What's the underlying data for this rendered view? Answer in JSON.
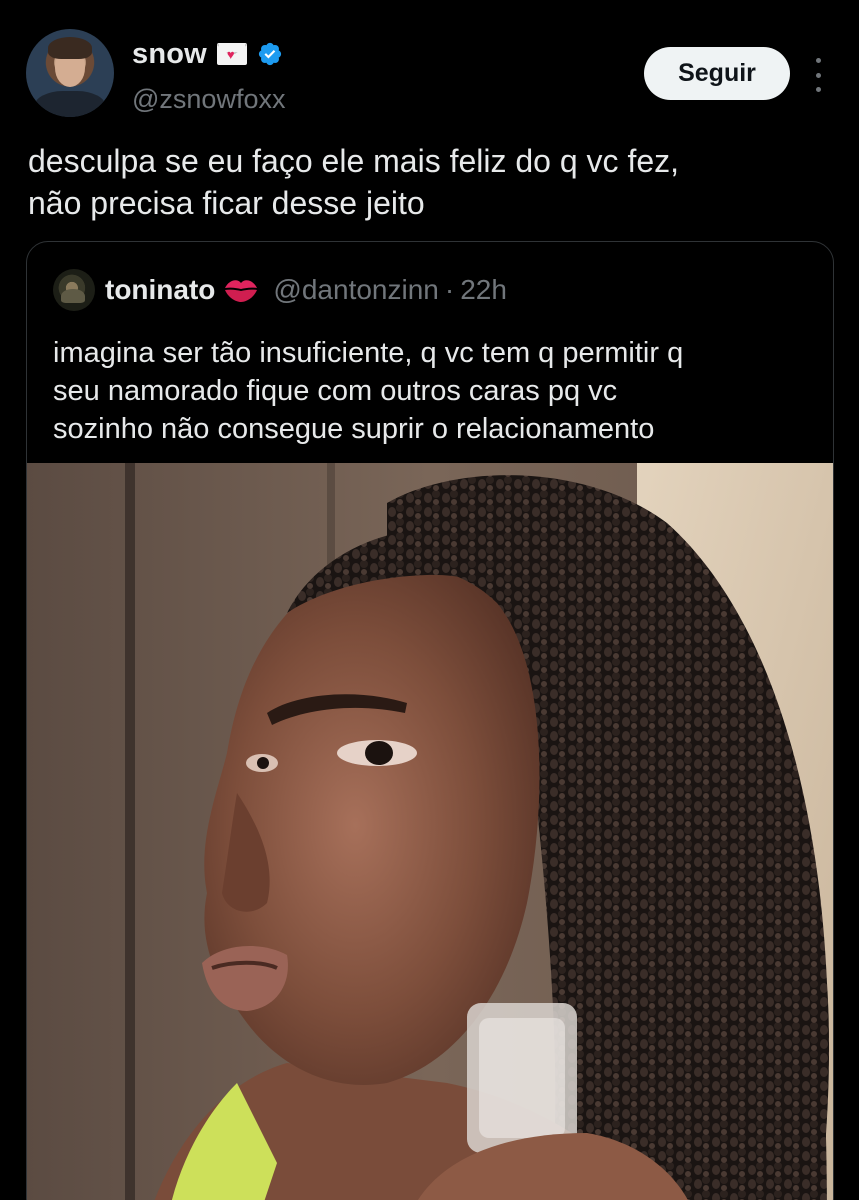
{
  "author": {
    "display_name": "snow",
    "name_emoji": "love-letter-emoji",
    "verified_badge": "verified-badge-icon",
    "handle": "@zsnowfoxx",
    "follow_label": "Seguir",
    "more_icon": "more-options-icon"
  },
  "tweet": {
    "text": "desculpa se eu faço ele mais feliz do q vc fez,\nnão precisa ficar desse jeito"
  },
  "quoted_tweet": {
    "display_name": "toninato",
    "name_emoji": "kiss-mark-emoji",
    "handle": "@dantonzinn",
    "separator": "·",
    "time": "22h",
    "text": "imagina ser tão insuficiente, q vc tem q permitir q\nseu namorado fique com outros caras pq vc\nsozinho não consegue suprir o relacionamento",
    "media": "photo"
  },
  "colors": {
    "background": "#000000",
    "primary_text": "#e7e9ea",
    "secondary_text": "#71767b",
    "border": "#2f3336",
    "verified_blue": "#1d9bf0",
    "follow_button_bg": "#eff3f4",
    "kiss_red": "#e0245e"
  }
}
